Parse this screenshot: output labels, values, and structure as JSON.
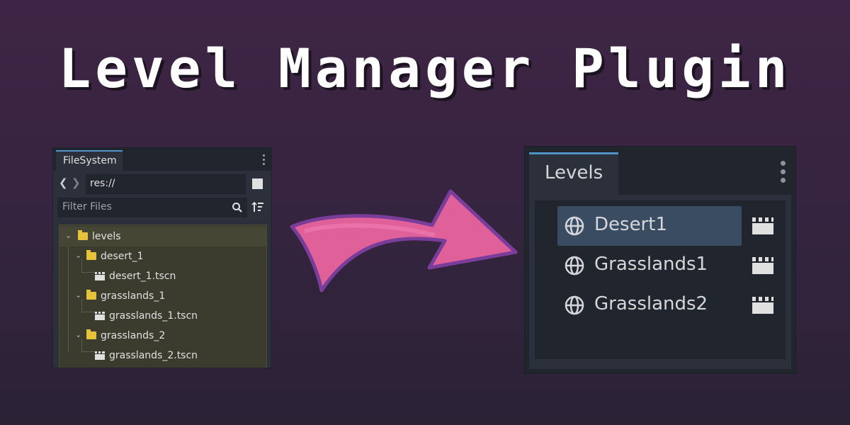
{
  "title": "Level Manager Plugin",
  "filesystem": {
    "tab_label": "FileSystem",
    "path": "res://",
    "filter_placeholder": "Filter Files",
    "tree": [
      {
        "label": "levels",
        "type": "folder"
      },
      {
        "label": "desert_1",
        "type": "folder"
      },
      {
        "label": "desert_1.tscn",
        "type": "scene"
      },
      {
        "label": "grasslands_1",
        "type": "folder"
      },
      {
        "label": "grasslands_1.tscn",
        "type": "scene"
      },
      {
        "label": "grasslands_2",
        "type": "folder"
      },
      {
        "label": "grasslands_2.tscn",
        "type": "scene"
      }
    ]
  },
  "levels_panel": {
    "tab_label": "Levels",
    "items": [
      {
        "label": "Desert1",
        "selected": true
      },
      {
        "label": "Grasslands1",
        "selected": false
      },
      {
        "label": "Grasslands2",
        "selected": false
      }
    ]
  },
  "colors": {
    "accent": "#4f93c8",
    "folder": "#e7c33c",
    "arrow": "#e0609a",
    "arrow_outline": "#7a3e9a"
  },
  "icons": [
    "chevron-left-icon",
    "chevron-right-icon",
    "search-icon",
    "sort-icon",
    "folder-icon",
    "scene-icon",
    "globe-icon",
    "clapperboard-icon",
    "kebab-menu-icon"
  ]
}
